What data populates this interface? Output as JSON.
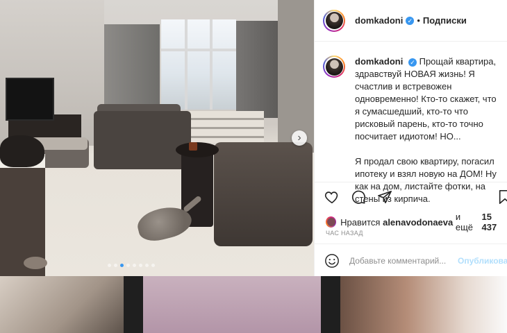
{
  "post": {
    "username": "domkadoni",
    "separator": "•",
    "follow_label": "Подписки",
    "verified_mark": "✓",
    "caption": "Прощай квартира, здравствуй НОВАЯ жизнь! Я счастлив и встревожен одновременно! Кто-то скажет, что я сумасшедший, кто-то что рисковый парень, кто-то точно посчитает идиотом! НО...\n\nЯ продал свою квартиру, погасил ипотеку и взял новую на ДОМ! Ну как на дом, листайте фотки, на стены из кирпича.",
    "likes_prefix": "Нравится",
    "liker": "alenavodonaeva",
    "likes_mid": "и ещё",
    "likes_count": "15 437",
    "time": "ЧАС НАЗАД",
    "comment_placeholder": "Добавьте комментарий...",
    "publish_label": "Опубликовать"
  },
  "carousel": {
    "next_arrow": "›",
    "dots_total": 8,
    "active_dot": 2
  },
  "icons": [
    "heart-icon",
    "comment-icon",
    "share-icon",
    "bookmark-icon",
    "emoji-icon",
    "chevron-right-icon"
  ],
  "colors": {
    "accent": "#3897f0",
    "text": "#262626",
    "muted": "#8e8e8e",
    "post_disabled": "#b2dffc"
  }
}
